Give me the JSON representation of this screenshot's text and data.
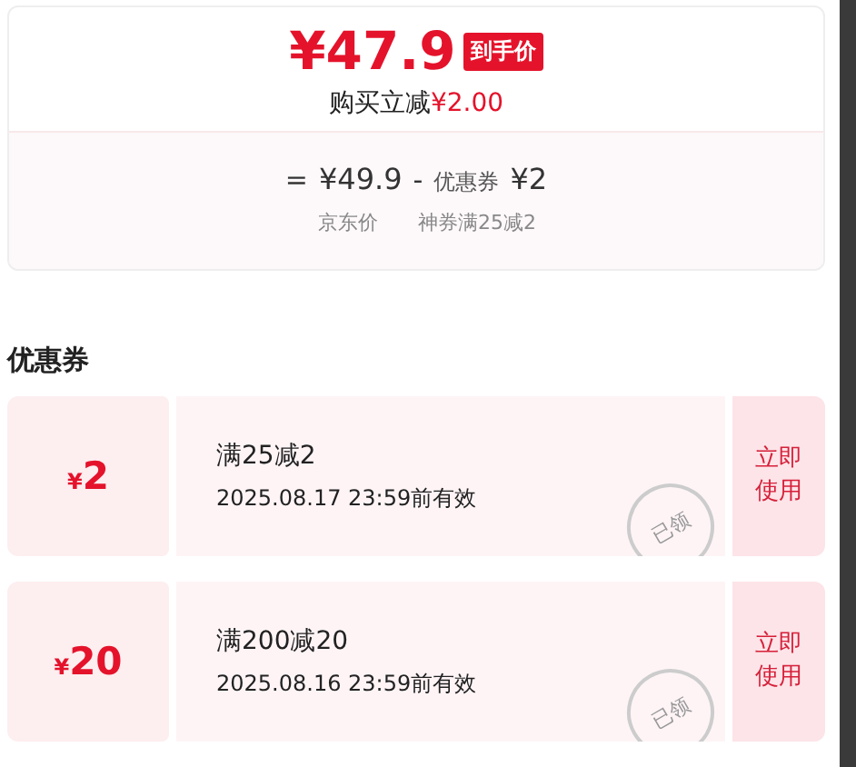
{
  "price_card": {
    "final_price": "¥47.9",
    "price_tag": "到手价",
    "saving_label": "购买立减",
    "saving_amount": "¥2.00",
    "breakdown": {
      "equals": "=",
      "base_price": "¥49.9",
      "minus": "-",
      "coupon_label": "优惠券",
      "coupon_amount": "¥2",
      "base_caption": "京东价",
      "coupon_caption": "神券满25减2"
    }
  },
  "coupons_section": {
    "title": "优惠券",
    "coupons": [
      {
        "currency": "¥",
        "amount": "2",
        "condition": "满25减2",
        "validity": "2025.08.17 23:59前有效",
        "action": "立即使用",
        "stamp": "已领"
      },
      {
        "currency": "¥",
        "amount": "20",
        "condition": "满200减20",
        "validity": "2025.08.16 23:59前有效",
        "action": "立即使用",
        "stamp": "已领"
      }
    ]
  }
}
